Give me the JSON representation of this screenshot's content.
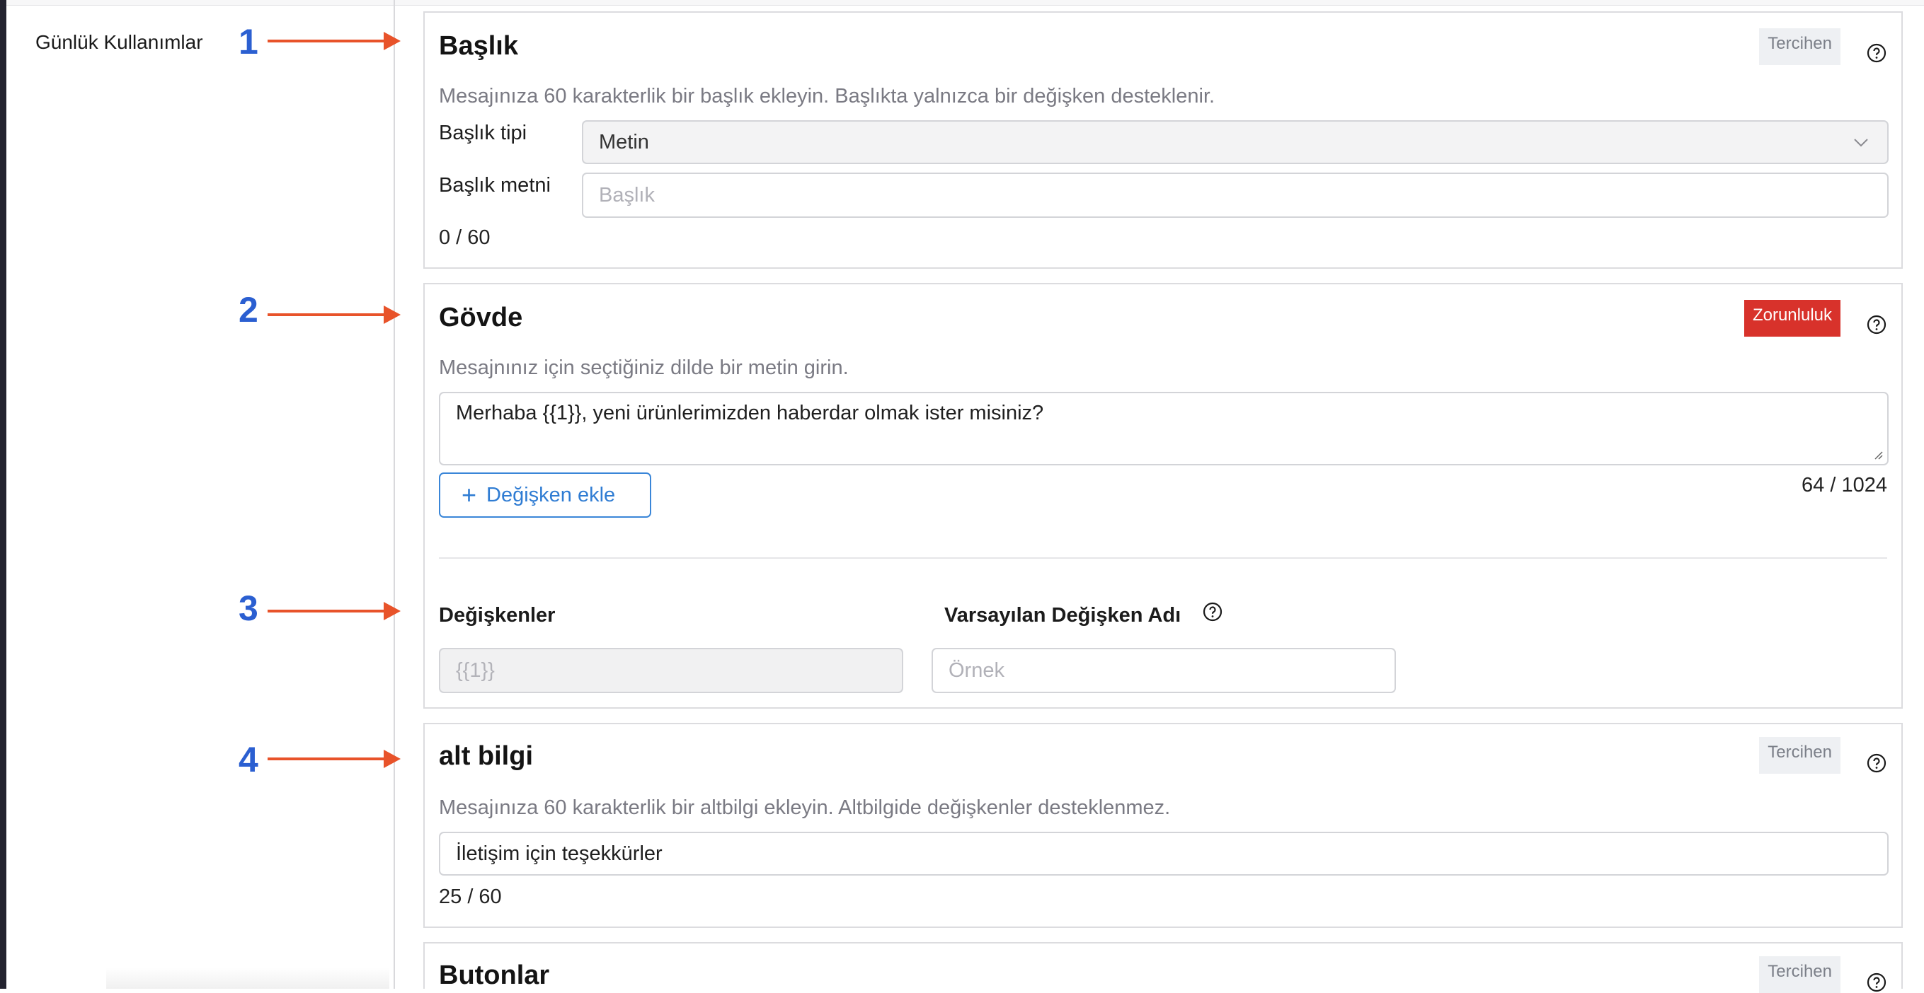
{
  "sidebar": {
    "title": "Günlük Kullanımlar"
  },
  "markers": [
    "1",
    "2",
    "3",
    "4"
  ],
  "colors": {
    "accent": "#2f7cd3",
    "required": "#d8322b",
    "marker_number": "#2b5fd1",
    "arrow": "#e8532a"
  },
  "header_section": {
    "title": "Başlık",
    "badge": "Tercihen",
    "description": "Mesajınıza 60 karakterlik bir başlık ekleyin. Başlıkta yalnızca bir değişken desteklenir.",
    "type_label": "Başlık tipi",
    "type_value": "Metin",
    "text_label": "Başlık metni",
    "text_placeholder": "Başlık",
    "counter": "0 / 60"
  },
  "body_section": {
    "title": "Gövde",
    "badge": "Zorunluluk",
    "description": "Mesajnınız için seçtiğiniz dilde bir metin girin.",
    "text_value": "Merhaba {{1}}, yeni ürünlerimizden haberdar olmak ister misiniz?",
    "counter": "64 / 1024",
    "add_variable_label": "Değişken ekle",
    "variables_heading": "Değişkenler",
    "default_name_heading": "Varsayılan Değişken Adı",
    "variable_value": "{{1}}",
    "default_name_placeholder": "Örnek"
  },
  "footer_section": {
    "title": "alt bilgi",
    "badge": "Tercihen",
    "description": "Mesajınıza 60 karakterlik bir altbilgi ekleyin. Altbilgide değişkenler desteklenmez.",
    "text_value": "İletişim için teşekkürler",
    "counter": "25 / 60"
  },
  "buttons_section": {
    "title": "Butonlar",
    "badge": "Tercihen"
  },
  "icons": [
    "help-circle-icon",
    "chevron-down-icon",
    "plus-icon",
    "resize-handle-icon",
    "arrow-right-icon"
  ]
}
